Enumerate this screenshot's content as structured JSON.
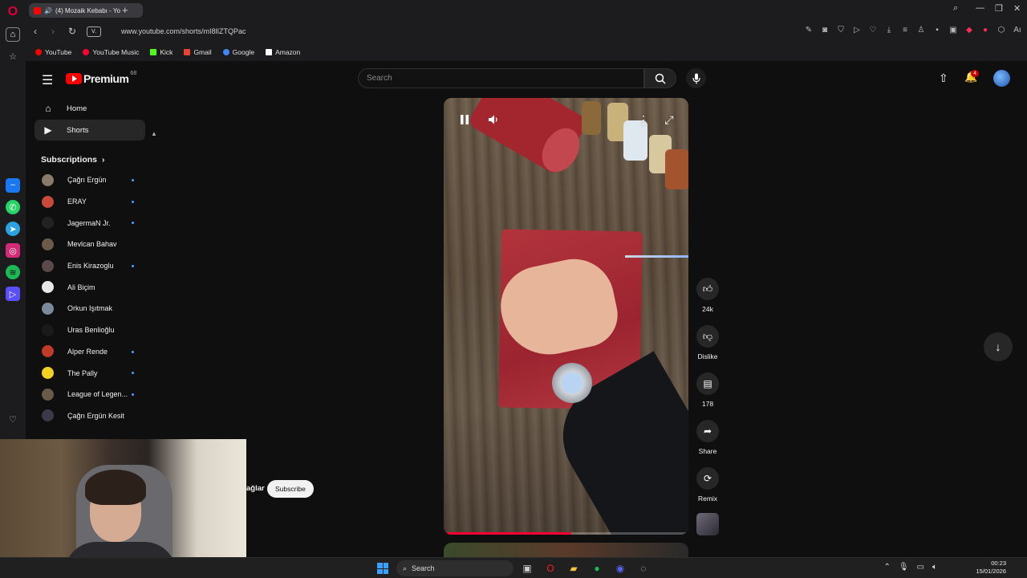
{
  "browser": {
    "tab_title": "(4) Mozaik Kebabı - Yo",
    "url": "www.youtube.com/shorts/mI8lIZTQPac",
    "badge": "V.",
    "bookmarks": [
      {
        "label": "YouTube",
        "color": "#ff0000"
      },
      {
        "label": "YouTube Music",
        "color": "#ff0033"
      },
      {
        "label": "Kick",
        "color": "#53fc18"
      },
      {
        "label": "Gmail",
        "color": "#ea4335"
      },
      {
        "label": "Google",
        "color": "#4285f4"
      },
      {
        "label": "Amazon",
        "color": "#ffffff"
      }
    ],
    "side_apps": [
      "messenger-icon",
      "whatsapp-icon",
      "telegram-icon",
      "instagram-icon",
      "spotify-icon",
      "player-icon"
    ]
  },
  "youtube": {
    "logo_text": "Premium",
    "logo_count": "68",
    "search_placeholder": "Search",
    "notification_count": "4",
    "guide": {
      "items": [
        {
          "label": "Home",
          "icon": "home-icon"
        },
        {
          "label": "Shorts",
          "icon": "shorts-icon",
          "active": true
        }
      ],
      "subscriptions_title": "Subscriptions",
      "subscriptions": [
        {
          "name": "Çağrı Ergün",
          "dot": true,
          "color": "#8a7a6a"
        },
        {
          "name": "ERAY",
          "dot": true,
          "color": "#c94a3a"
        },
        {
          "name": "JagermaN Jr.",
          "dot": true,
          "color": "#222222"
        },
        {
          "name": "Mevlcan Bahav",
          "dot": false,
          "color": "#6b5a4a"
        },
        {
          "name": "Enis Kirazoglu",
          "dot": true,
          "color": "#5a4a4a"
        },
        {
          "name": "Ali Biçim",
          "dot": false,
          "color": "#e8e8e8"
        },
        {
          "name": "Orkun Işıtmak",
          "dot": false,
          "color": "#7a8a9a"
        },
        {
          "name": "Uras Benlioğlu",
          "dot": false,
          "color": "#1a1a1a"
        },
        {
          "name": "Alper Rende",
          "dot": true,
          "color": "#c03a2a"
        },
        {
          "name": "The Pally",
          "dot": true,
          "color": "#f2d020"
        },
        {
          "name": "League of Legen...",
          "dot": true,
          "color": "#6a5a4a"
        },
        {
          "name": "Çağrı Ergün Kesit",
          "dot": false,
          "color": "#3a3a4a"
        }
      ]
    },
    "short": {
      "progress_fraction": 0.52,
      "channel_fragment": "ağlar",
      "subscribe_label": "Subscribe"
    },
    "actions": [
      {
        "name": "like",
        "icon": "thumbs-up-icon",
        "label": "24k"
      },
      {
        "name": "dislike",
        "icon": "thumbs-down-icon",
        "label": "Dislike"
      },
      {
        "name": "comments",
        "icon": "comment-icon",
        "label": "178"
      },
      {
        "name": "share",
        "icon": "share-icon",
        "label": "Share"
      },
      {
        "name": "remix",
        "icon": "remix-icon",
        "label": "Remix"
      }
    ]
  },
  "taskbar": {
    "search_label": "Search",
    "time": "00:23",
    "date": "15/01/2026"
  }
}
